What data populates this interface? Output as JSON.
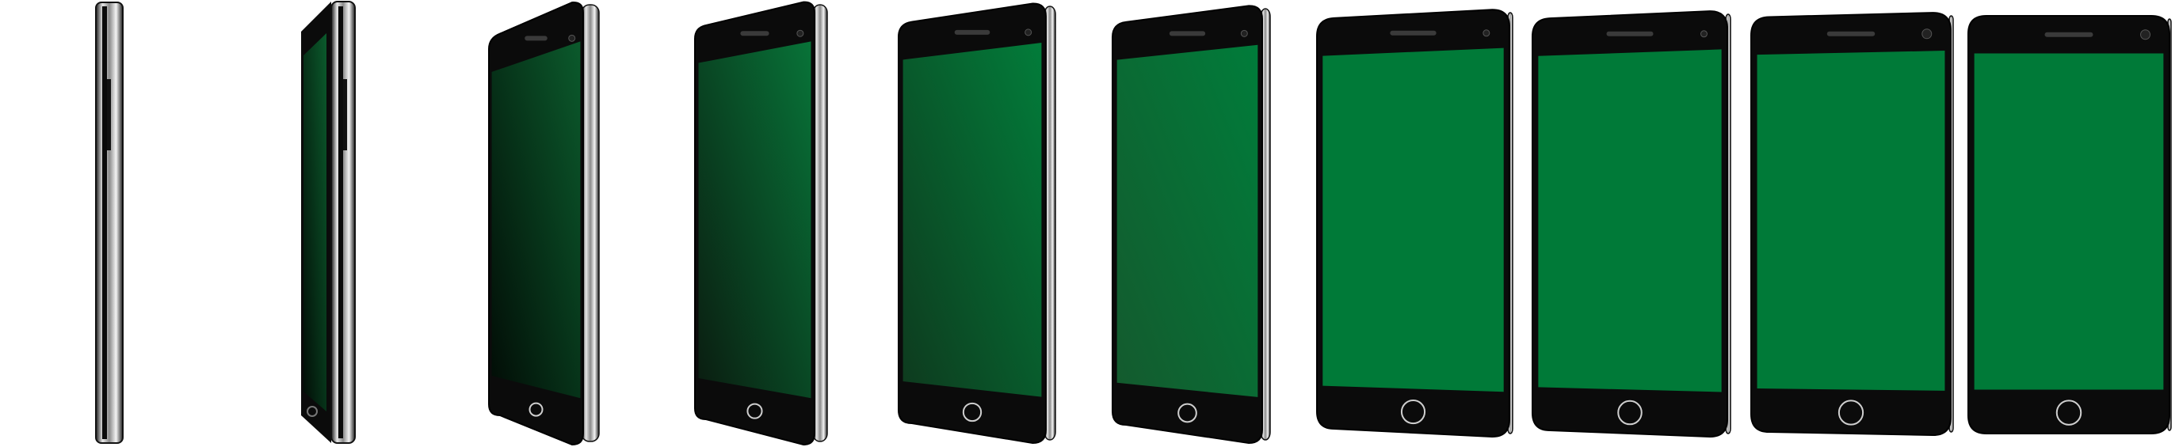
{
  "scene": {
    "subject": "smartphone-rotation-sequence",
    "background_color": "#ffffff",
    "screen_color": "#007a38",
    "screen_shadow_color": "#0c2414",
    "body_color": "#0b0b0b",
    "chrome_color": "#c8c8c8",
    "phone_count": 10
  }
}
